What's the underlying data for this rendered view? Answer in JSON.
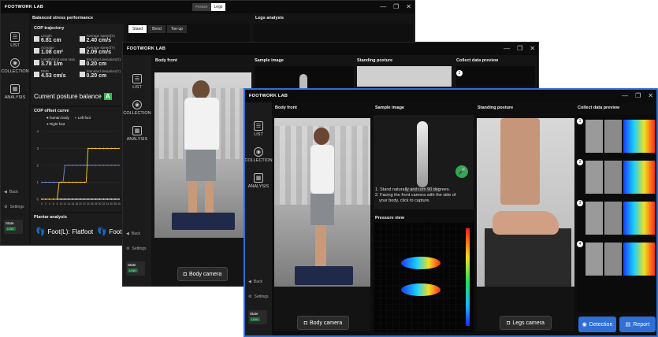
{
  "app": {
    "logo": "FOOTWORK LAB"
  },
  "window_controls": {
    "minimize": "—",
    "maximize": "❐",
    "close": "✕"
  },
  "sidebar": {
    "list": "LIST",
    "collection": "COLLECTION",
    "analysis": "ANALYSIS",
    "back": "Back",
    "settings": "Settings",
    "state": "State",
    "link": "LINK",
    "link_small": "LINK"
  },
  "win1": {
    "top_tabs": [
      "Posture",
      "Legs"
    ],
    "sections": {
      "balanced": "Balanced stress performance",
      "legs_analysis": "Legs analysis",
      "cop_trajectory": "COP trajectory",
      "cop_offset": "COP offset curve",
      "plantar": "Plantar analysis"
    },
    "stance_tabs": [
      "Stand",
      "Bend",
      "Toe-up"
    ],
    "metrics": [
      {
        "label": "Length",
        "value": "6.81 cm"
      },
      {
        "label": "Average speed(X)",
        "value": "2.40 cm/s"
      },
      {
        "label": "Acreage",
        "value": "1.08 cm²"
      },
      {
        "label": "Average speed(Y)",
        "value": "2.09 cm/s"
      },
      {
        "label": "Length/Unit area ratio",
        "value": "3.78 1/m"
      },
      {
        "label": "Standard deviation(X)",
        "value": "0.20 cm"
      },
      {
        "label": "RMS",
        "value": "4.53 cm/s"
      },
      {
        "label": "Standard deviation(Y)",
        "value": "0.20 cm"
      }
    ],
    "balance_label": "Current posture balance",
    "balance_grade": "A",
    "legend": [
      "human body",
      "Left foot",
      "Right foot"
    ],
    "chart_yticks": [
      "4",
      "3",
      "2",
      "1",
      "0"
    ],
    "chart_xticks": [
      "0",
      "2",
      "4",
      "6",
      "8",
      "10",
      "12",
      "14",
      "16",
      "18",
      "20",
      "22",
      "24",
      "26",
      "28",
      "30",
      "32",
      "34",
      "36",
      "38",
      "40"
    ],
    "foot_left_label": "Foot(L):",
    "foot_left_value": "Flatfoot",
    "foot_right_label": "Foot("
  },
  "win2": {
    "headers": {
      "body_front": "Body front",
      "sample": "Sample image",
      "standing": "Standing posture",
      "collect": "Collect data preview"
    },
    "camera_btn": "Body camera"
  },
  "win3": {
    "headers": {
      "body_front": "Body front",
      "sample": "Sample image",
      "standing": "Standing posture",
      "collect": "Collect data preview",
      "pressure": "Pressure view"
    },
    "instructions": [
      "1. Stand naturally and turn 90 degrees.",
      "2. Facing the front camera with the side of",
      "your body, click to capture."
    ],
    "body_camera_btn": "Body camera",
    "legs_camera_btn": "Legs camera",
    "detection_btn": "Detection",
    "report_btn": "Report",
    "preview_indices": [
      "1",
      "2",
      "3",
      "4"
    ]
  },
  "chart_data": {
    "type": "line",
    "title": "COP offset curve",
    "ylim": [
      0,
      4
    ],
    "series": [
      {
        "name": "human body",
        "color": "#e8e8e8",
        "x": [
          0,
          40
        ],
        "y": [
          0,
          0
        ]
      },
      {
        "name": "Left foot",
        "color": "#6f7fbf",
        "x": [
          0,
          11,
          12,
          40
        ],
        "y": [
          1,
          1,
          2,
          2
        ]
      },
      {
        "name": "Right foot",
        "color": "#f0c020",
        "x": [
          0,
          8,
          9,
          23,
          24,
          40
        ],
        "y": [
          0,
          0,
          1,
          1,
          3,
          3
        ]
      }
    ]
  },
  "colors": {
    "accent_blue": "#2f6fd6",
    "grade_green": "#2fbf4f",
    "mic_green": "#2fa84f"
  }
}
